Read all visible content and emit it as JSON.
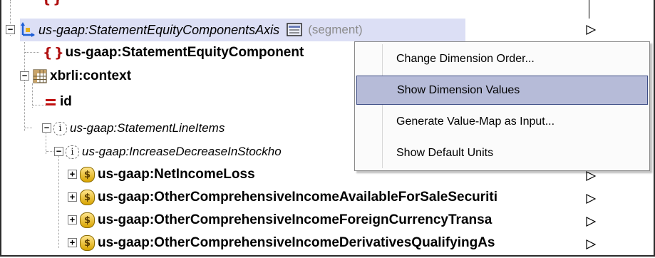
{
  "tree": {
    "row_axis": {
      "label": "us-gaap:StatementEquityComponentsAxis",
      "suffix": "(segment)"
    },
    "row_component": {
      "label": "us-gaap:StatementEquityComponent"
    },
    "row_context": {
      "label": "xbrli:context"
    },
    "row_id": {
      "label": "id"
    },
    "row_lineitems": {
      "label": "us-gaap:StatementLineItems"
    },
    "row_increase": {
      "label": "us-gaap:IncreaseDecreaseInStockho"
    },
    "items": [
      {
        "label": "us-gaap:NetIncomeLoss"
      },
      {
        "label": "us-gaap:OtherComprehensiveIncomeAvailableForSaleSecuriti"
      },
      {
        "label": "us-gaap:OtherComprehensiveIncomeForeignCurrencyTransa"
      },
      {
        "label": "us-gaap:OtherComprehensiveIncomeDerivativesQualifyingAs"
      }
    ]
  },
  "context_menu": {
    "items": [
      {
        "label": "Change Dimension Order...",
        "highlighted": false
      },
      {
        "label": "Show Dimension Values",
        "highlighted": true
      },
      {
        "label": "Generate Value-Map as Input...",
        "highlighted": false
      },
      {
        "label": "Show Default Units",
        "highlighted": false
      }
    ]
  },
  "icons": {
    "axis": "dimension-axis-icon",
    "value_map": "value-map-icon",
    "element": "element-braces-icon",
    "context": "grid-icon",
    "attribute": "attribute-icon",
    "info": "info-icon",
    "monetary": "monetary-icon",
    "connector": "connector-icon"
  },
  "colors": {
    "selection": "#dcdff5",
    "menu_highlight": "#b6bbd8",
    "menu_highlight_border": "#3d4d85",
    "element_icon": "#b01010"
  }
}
